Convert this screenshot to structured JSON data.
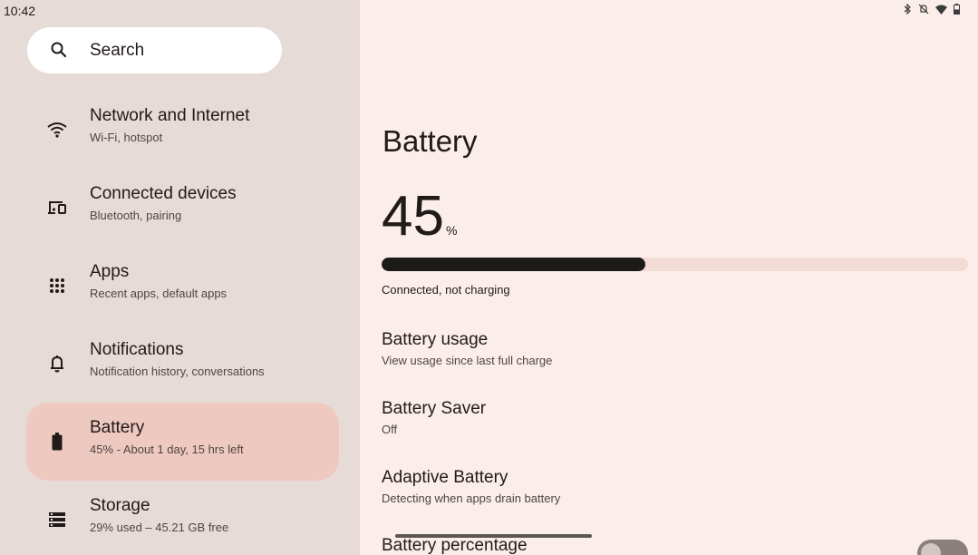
{
  "status_bar": {
    "time": "10:42",
    "icons": [
      "bluetooth-icon",
      "mute-icon",
      "wifi-icon",
      "battery-icon"
    ]
  },
  "search": {
    "label": "Search"
  },
  "sidebar": {
    "items": [
      {
        "title": "Network and Internet",
        "subtitle": "Wi-Fi, hotspot",
        "icon": "wifi-icon",
        "active": false
      },
      {
        "title": "Connected devices",
        "subtitle": "Bluetooth, pairing",
        "icon": "devices-icon",
        "active": false
      },
      {
        "title": "Apps",
        "subtitle": "Recent apps, default apps",
        "icon": "apps-grid-icon",
        "active": false
      },
      {
        "title": "Notifications",
        "subtitle": "Notification history, conversations",
        "icon": "bell-icon",
        "active": false
      },
      {
        "title": "Battery",
        "subtitle": "45% - About 1 day, 15 hrs left",
        "icon": "battery-icon",
        "active": true
      },
      {
        "title": "Storage",
        "subtitle": "29% used – 45.21 GB free",
        "icon": "storage-icon",
        "active": false
      }
    ]
  },
  "battery": {
    "title": "Battery",
    "percent": "45",
    "percent_unit": "%",
    "level": 0.45,
    "status": "Connected, not charging"
  },
  "preferences": [
    {
      "title": "Battery usage",
      "subtitle": "View usage since last full charge"
    },
    {
      "title": "Battery Saver",
      "subtitle": "Off"
    },
    {
      "title": "Adaptive Battery",
      "subtitle": "Detecting when apps drain battery"
    },
    {
      "title": "Battery percentage",
      "subtitle": ""
    }
  ],
  "colors": {
    "sidebar_bg": "#e7dbd8",
    "content_bg": "#fbeeea",
    "active_item": "#eec9bf",
    "bar_fill": "#1d1b1a",
    "bar_track": "#f4dcd6"
  }
}
